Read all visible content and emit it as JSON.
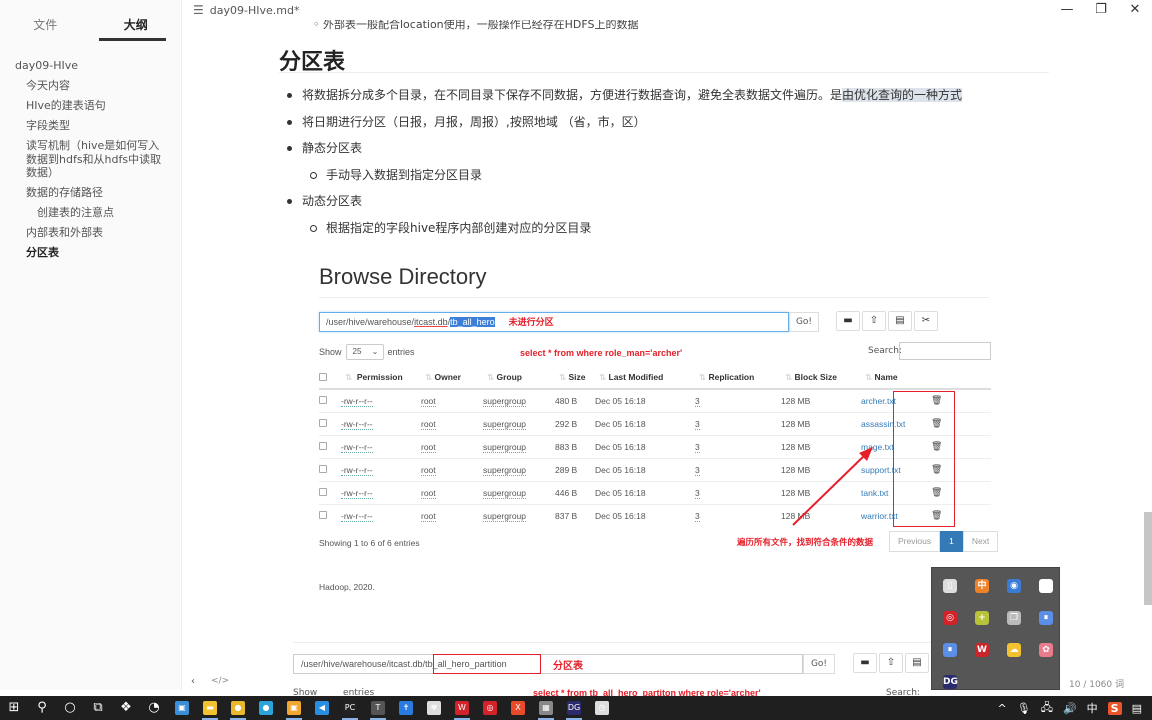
{
  "window": {
    "title": "day09-HIve.md*",
    "controls": {
      "minimize": "—",
      "maximize": "❐",
      "close": "✕"
    }
  },
  "sidebar": {
    "tabs": [
      {
        "label": "文件",
        "active": false
      },
      {
        "label": "大纲",
        "active": true
      }
    ],
    "outline": [
      {
        "label": "day09-HIve",
        "level": 1
      },
      {
        "label": "今天内容",
        "level": 2
      },
      {
        "label": "HIve的建表语句",
        "level": 2
      },
      {
        "label": "字段类型",
        "level": 2
      },
      {
        "label": "读写机制（hive是如何写入数据到hdfs和从hdfs中读取数据）",
        "level": 2
      },
      {
        "label": "数据的存储路径",
        "level": 2
      },
      {
        "label": "创建表的注意点",
        "level": 3
      },
      {
        "label": "内部表和外部表",
        "level": 2
      },
      {
        "label": "分区表",
        "level": 2,
        "active": true
      }
    ]
  },
  "doc": {
    "cut_line": "外部表一般配合location使用，一般操作已经存在HDFS上的数据",
    "heading": "分区表",
    "bullets": [
      {
        "text": "将数据拆分成多个目录，在不同目录下保存不同数据，方便进行数据查询，避免全表数据文件遍历。是",
        "highlight": "由优化查询的一种方式",
        "level": 1
      },
      {
        "text": "将日期进行分区（日报，月报，周报）,按照地域 （省，市，区）",
        "level": 1
      },
      {
        "text": "静态分区表",
        "level": 1
      },
      {
        "text": "手动导入数据到指定分区目录",
        "level": 2
      },
      {
        "text": "动态分区表",
        "level": 1
      },
      {
        "text": "根据指定的字段hive程序内部创建对应的分区目录",
        "level": 2
      }
    ]
  },
  "browse1": {
    "title": "Browse Directory",
    "path_prefix": "/user/hive/warehouse/",
    "path_db": "itcast.db",
    "path_sep": "/",
    "path_selected": "tb_all_hero",
    "annotation": "未进行分区",
    "go_label": "Go!",
    "toolbar_icons": [
      "folder-open-icon",
      "upload-icon",
      "file-icon",
      "cut-icon"
    ],
    "show_label": "Show",
    "entries_value": "25",
    "entries_label": "entries",
    "query": "select * from where role_man='archer'",
    "search_label": "Search:",
    "columns": [
      "Permission",
      "Owner",
      "Group",
      "Size",
      "Last Modified",
      "Replication",
      "Block Size",
      "Name"
    ],
    "rows": [
      {
        "permission": "-rw-r--r--",
        "owner": "root",
        "group": "supergroup",
        "size": "480 B",
        "modified": "Dec 05 16:18",
        "replication": "3",
        "block": "128 MB",
        "name": "archer.txt"
      },
      {
        "permission": "-rw-r--r--",
        "owner": "root",
        "group": "supergroup",
        "size": "292 B",
        "modified": "Dec 05 16:18",
        "replication": "3",
        "block": "128 MB",
        "name": "assassin.txt"
      },
      {
        "permission": "-rw-r--r--",
        "owner": "root",
        "group": "supergroup",
        "size": "883 B",
        "modified": "Dec 05 16:18",
        "replication": "3",
        "block": "128 MB",
        "name": "mage.txt"
      },
      {
        "permission": "-rw-r--r--",
        "owner": "root",
        "group": "supergroup",
        "size": "289 B",
        "modified": "Dec 05 16:18",
        "replication": "3",
        "block": "128 MB",
        "name": "support.txt"
      },
      {
        "permission": "-rw-r--r--",
        "owner": "root",
        "group": "supergroup",
        "size": "446 B",
        "modified": "Dec 05 16:18",
        "replication": "3",
        "block": "128 MB",
        "name": "tank.txt"
      },
      {
        "permission": "-rw-r--r--",
        "owner": "root",
        "group": "supergroup",
        "size": "837 B",
        "modified": "Dec 05 16:18",
        "replication": "3",
        "block": "128 MB",
        "name": "warrior.txt"
      }
    ],
    "showing": "Showing 1 to 6 of 6 entries",
    "annotation2": "遍历所有文件，找到符合条件的数据",
    "pager": {
      "previous": "Previous",
      "current": "1",
      "next": "Next"
    },
    "footer": "Hadoop, 2020."
  },
  "browse2": {
    "path_prefix": "/user/hive/warehouse/itcast.db",
    "path_table": "/tb_all_hero_partition",
    "annotation": "分区表",
    "go_label": "Go!",
    "show_label": "Show",
    "entries_label": "entries",
    "query": "select * from tb_all_hero_partiton  where role='archer'",
    "search_label": "Search:"
  },
  "statusbar": {
    "nav_icon": "‹",
    "code_icon": "</>",
    "word_count": "10 / 1060 词"
  },
  "tray_popup": {
    "icons": [
      {
        "name": "usb-drive-icon",
        "glyph": "▯",
        "color": "#ddd"
      },
      {
        "name": "chinese-ime-icon",
        "glyph": "中",
        "color": "#f0822a"
      },
      {
        "name": "sync-icon",
        "glyph": "◉",
        "color": "#3a7bd5"
      },
      {
        "name": "bookmark-icon",
        "glyph": "▚",
        "color": "#fff"
      },
      {
        "name": "netease-music-icon",
        "glyph": "◎",
        "color": "#d2232a"
      },
      {
        "name": "plus-app-icon",
        "glyph": "+",
        "color": "#b8c23a"
      },
      {
        "name": "copy-icon",
        "glyph": "❐",
        "color": "#bbb"
      },
      {
        "name": "pause-icon-1",
        "glyph": "⏸",
        "color": "#5b8ee6"
      },
      {
        "name": "pause-icon-2",
        "glyph": "⏸",
        "color": "#5b8ee6"
      },
      {
        "name": "wps-icon",
        "glyph": "W",
        "color": "#c9262b"
      },
      {
        "name": "weather-icon",
        "glyph": "☁",
        "color": "#f2c230"
      },
      {
        "name": "baidu-icon",
        "glyph": "✿",
        "color": "#e87b8c"
      },
      {
        "name": "datagrip-icon",
        "glyph": "DG",
        "color": "#2b2b6e"
      }
    ]
  },
  "taskbar": {
    "apps": [
      {
        "name": "windows-start-icon",
        "glyph": "⊞",
        "color": "#fff"
      },
      {
        "name": "search-icon",
        "glyph": "⚲",
        "color": "#fff"
      },
      {
        "name": "cortana-icon",
        "glyph": "○",
        "color": "#fff"
      },
      {
        "name": "task-view-icon",
        "glyph": "⧉",
        "color": "#fff"
      },
      {
        "name": "app-grid-icon",
        "glyph": "❖",
        "color": "#fff"
      },
      {
        "name": "magnifier-icon",
        "glyph": "◔",
        "color": "#fff"
      },
      {
        "name": "store-icon",
        "glyph": "▣",
        "color": "#3b8ed8"
      },
      {
        "name": "file-explorer-icon",
        "glyph": "▬",
        "color": "#f2c230",
        "running": true
      },
      {
        "name": "chrome-icon",
        "glyph": "●",
        "color": "#e9b82c",
        "running": true
      },
      {
        "name": "edge-icon",
        "glyph": "●",
        "color": "#2aa4d8"
      },
      {
        "name": "virtualbox-icon",
        "glyph": "▣",
        "color": "#f0a830",
        "running": true
      },
      {
        "name": "vscode-icon",
        "glyph": "◀",
        "color": "#2a8ee0"
      },
      {
        "name": "pycharm-icon",
        "glyph": "PC",
        "color": "#222",
        "running": true
      },
      {
        "name": "typora-icon",
        "glyph": "T",
        "color": "#555",
        "running": true
      },
      {
        "name": "bookmark-app-icon",
        "glyph": "✝",
        "color": "#2a7be0"
      },
      {
        "name": "settings-app-icon",
        "glyph": "✾",
        "color": "#ddd"
      },
      {
        "name": "wps-icon",
        "glyph": "W",
        "color": "#d2232a",
        "running": true
      },
      {
        "name": "netease-music-icon",
        "glyph": "◎",
        "color": "#d2232a"
      },
      {
        "name": "xmind-icon",
        "glyph": "X",
        "color": "#e84a2a"
      },
      {
        "name": "calculator-icon",
        "glyph": "▦",
        "color": "#888",
        "running": true
      },
      {
        "name": "datagrip-icon",
        "glyph": "DG",
        "color": "#2b2b6e",
        "running": true
      },
      {
        "name": "clock-app-icon",
        "glyph": "◷",
        "color": "#ddd"
      }
    ],
    "tray": {
      "chevron": "^",
      "mic": "🎙",
      "network": "🖧",
      "volume": "🔊",
      "ime": "中",
      "sogou": "S",
      "notifications": "▤"
    }
  }
}
